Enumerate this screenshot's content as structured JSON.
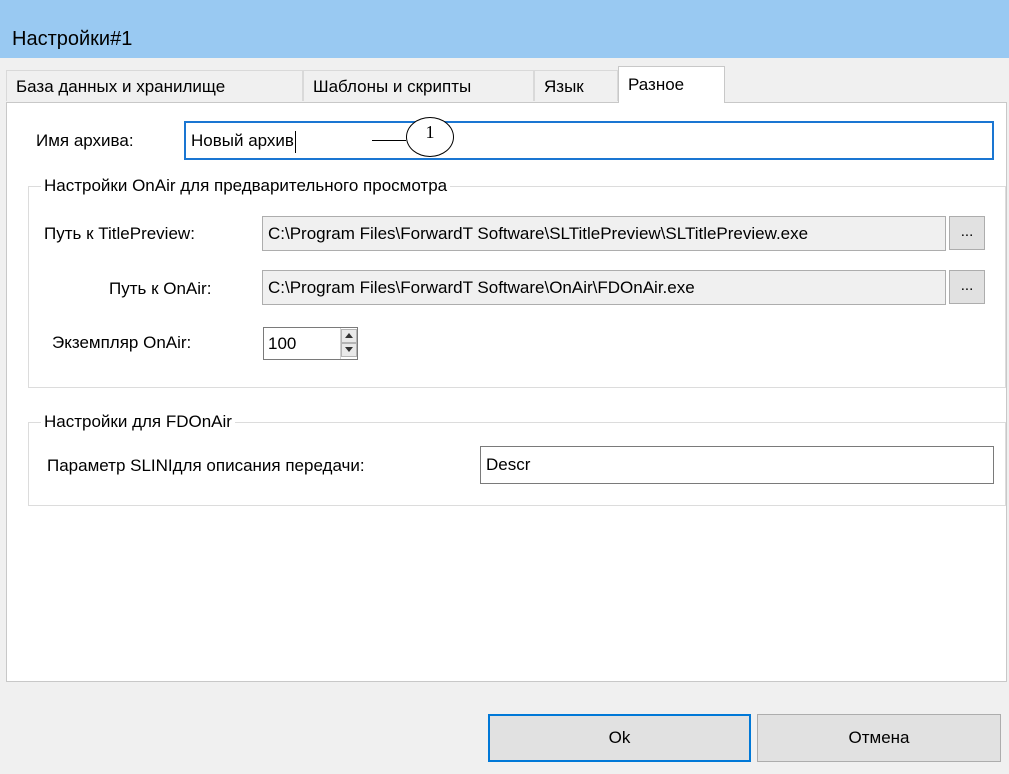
{
  "window": {
    "title": "Настройки#1"
  },
  "tabs": [
    {
      "label": "База данных и хранилище",
      "active": false
    },
    {
      "label": "Шаблоны и скрипты",
      "active": false
    },
    {
      "label": "Язык",
      "active": false
    },
    {
      "label": "Разное",
      "active": true
    }
  ],
  "archive": {
    "label": "Имя архива:",
    "value": "Новый архив"
  },
  "onair_group": {
    "title": "Настройки OnAir для предварительного просмотра",
    "title_preview_label": "Путь к TitlePreview:",
    "title_preview_value": "C:\\Program Files\\ForwardT Software\\SLTitlePreview\\SLTitlePreview.exe",
    "onair_path_label": "Путь к OnAir:",
    "onair_path_value": "C:\\Program Files\\ForwardT Software\\OnAir\\FDOnAir.exe",
    "instance_label": "Экземпляр OnAir:",
    "instance_value": "100",
    "browse_label": "..."
  },
  "fdonair_group": {
    "title": "Настройки для FDOnAir",
    "param_label": "Параметр SLINIдля описания передачи:",
    "param_value": "Descr"
  },
  "buttons": {
    "ok": "Ok",
    "cancel": "Отмена"
  },
  "callout": {
    "number": "1"
  },
  "colors": {
    "titlebar": "#99c9f2",
    "focus_border": "#1a76d2",
    "default_button_border": "#0078d7"
  }
}
